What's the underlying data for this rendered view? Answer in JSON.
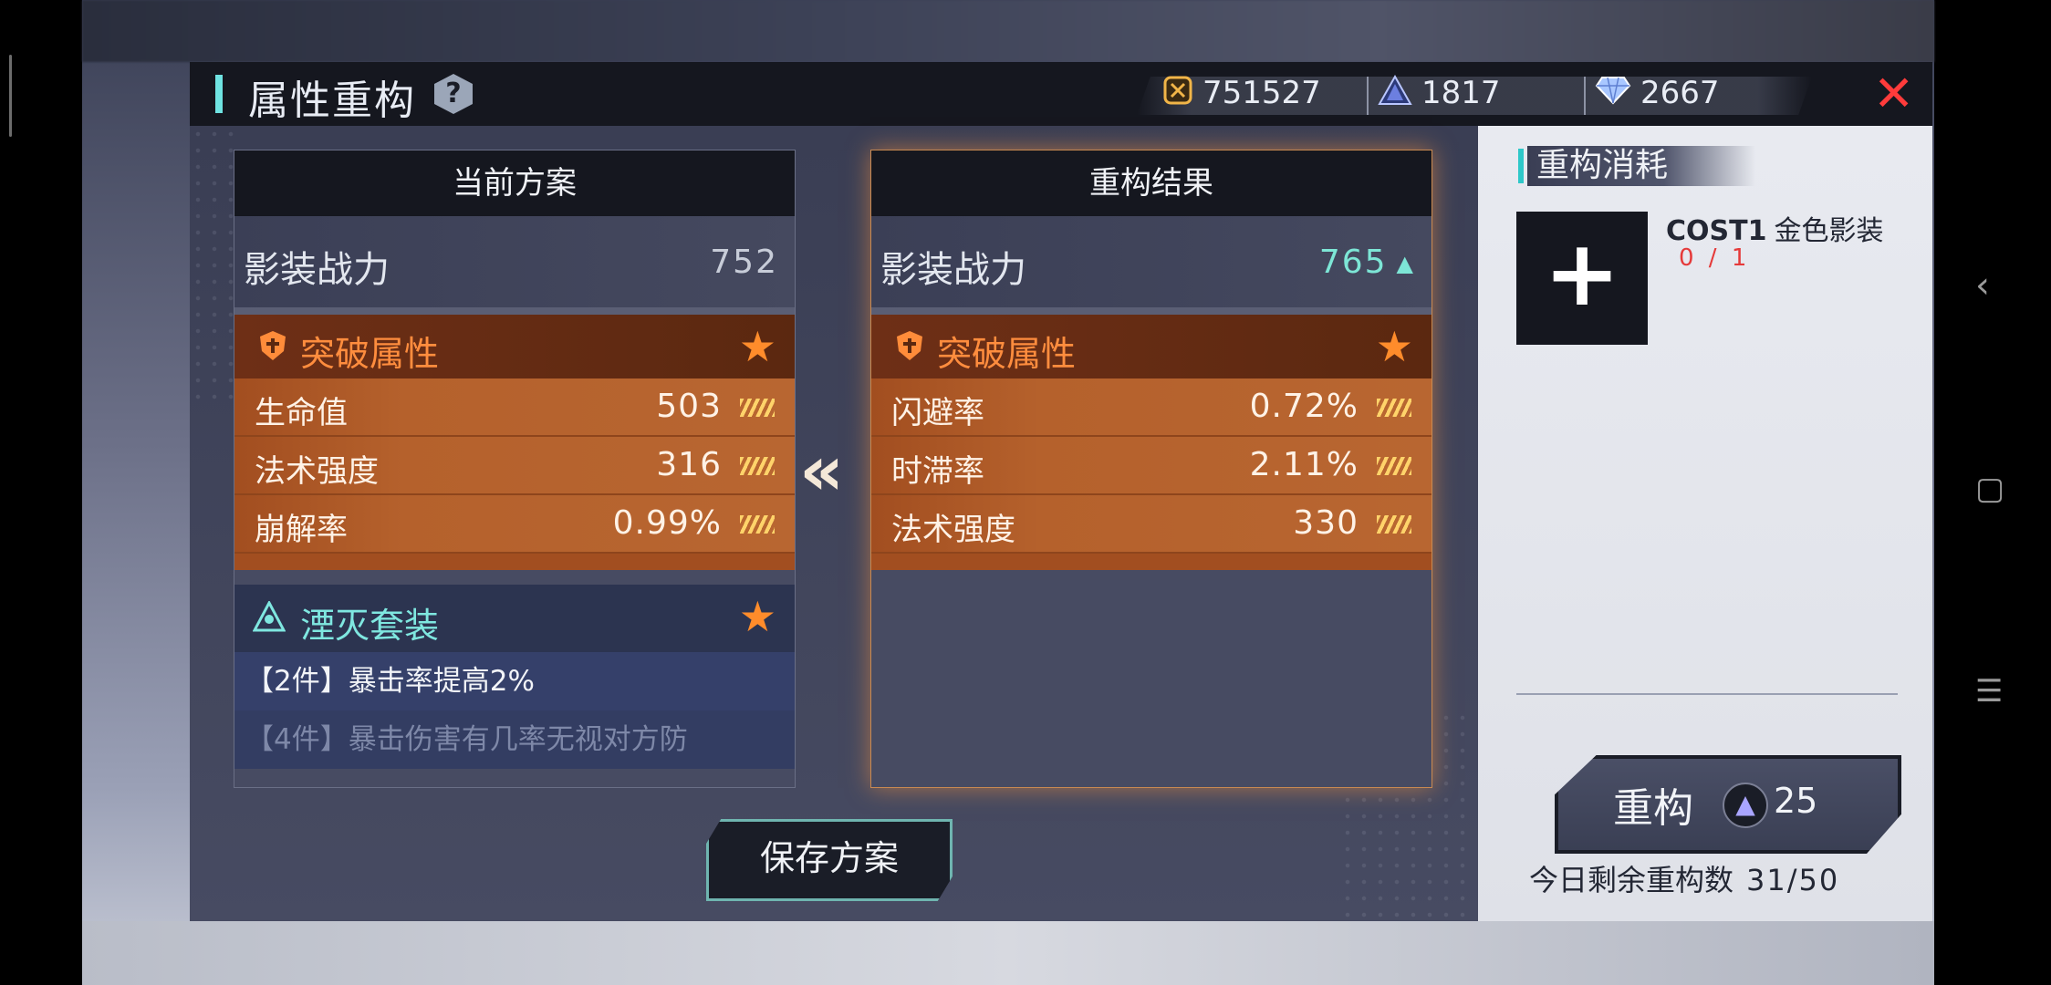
{
  "header": {
    "title": "属性重构",
    "help_icon": "question-icon",
    "currencies": [
      {
        "icon": "gold-coin-icon",
        "value": "751527"
      },
      {
        "icon": "pyramid-crystal-icon",
        "value": "1817"
      },
      {
        "icon": "diamond-icon",
        "value": "2667"
      }
    ],
    "close_icon": "close-x-icon"
  },
  "current_plan": {
    "title": "当前方案",
    "power_label": "影装战力",
    "power_value": "752",
    "breakthrough_title": "突破属性",
    "attributes": [
      {
        "label": "生命值",
        "value": "503"
      },
      {
        "label": "法术强度",
        "value": "316"
      },
      {
        "label": "崩解率",
        "value": "0.99%"
      }
    ],
    "set_title": "湮灭套装",
    "set_effects": [
      "【2件】暴击率提高2%",
      "【4件】暴击伤害有几率无视对方防"
    ]
  },
  "result_plan": {
    "title": "重构结果",
    "power_label": "影装战力",
    "power_value": "765",
    "breakthrough_title": "突破属性",
    "attributes": [
      {
        "label": "闪避率",
        "value": "0.72%"
      },
      {
        "label": "时滞率",
        "value": "2.11%"
      },
      {
        "label": "法术强度",
        "value": "330"
      }
    ]
  },
  "save_button": "保存方案",
  "cost_panel": {
    "title": "重构消耗",
    "cost_label": "COST1",
    "cost_item": "金色影装",
    "cost_count": "0 / 1"
  },
  "recast_button": {
    "label": "重构",
    "cost": "25"
  },
  "remaining": {
    "label": "今日剩余重构数",
    "value": "31/50"
  },
  "colors": {
    "accent_orange": "#ff8c2b",
    "accent_cyan": "#7fe7e0",
    "close_red": "#ff3b3b"
  }
}
